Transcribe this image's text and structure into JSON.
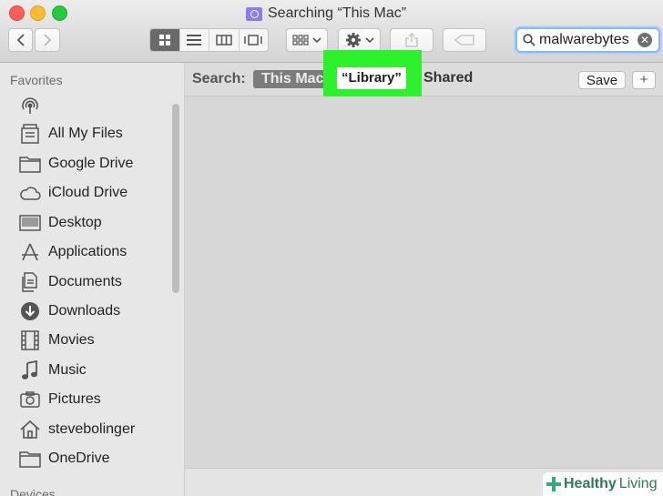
{
  "window": {
    "title": "Searching “This Mac”"
  },
  "toolbar": {
    "back_icon": "chevron-left-icon",
    "forward_icon": "chevron-right-icon",
    "views": [
      "icon-view",
      "list-view",
      "column-view",
      "cover-flow-view"
    ],
    "active_view": "icon-view",
    "arrange_icon": "arrange-grid-icon",
    "action_icon": "gear-icon",
    "share_icon": "share-icon",
    "tags_icon": "tag-icon",
    "search_value": "malwarebytes"
  },
  "sidebar": {
    "heading": "Favorites",
    "items": [
      {
        "label": "",
        "icon": "airdrop-icon"
      },
      {
        "label": "All My Files",
        "icon": "all-files-icon"
      },
      {
        "label": "Google Drive",
        "icon": "folder-icon"
      },
      {
        "label": "iCloud Drive",
        "icon": "cloud-icon"
      },
      {
        "label": "Desktop",
        "icon": "desktop-icon"
      },
      {
        "label": "Applications",
        "icon": "applications-icon"
      },
      {
        "label": "Documents",
        "icon": "documents-icon"
      },
      {
        "label": "Downloads",
        "icon": "downloads-icon"
      },
      {
        "label": "Movies",
        "icon": "movies-icon"
      },
      {
        "label": "Music",
        "icon": "music-icon"
      },
      {
        "label": "Pictures",
        "icon": "pictures-icon"
      },
      {
        "label": "stevebolinger",
        "icon": "home-icon"
      },
      {
        "label": "OneDrive",
        "icon": "folder-icon"
      }
    ],
    "devices_heading": "Devices"
  },
  "scope": {
    "label": "Search:",
    "this_mac": "This Mac",
    "library": "“Library”",
    "shared": "Shared",
    "save": "Save",
    "add": "+"
  },
  "watermark": {
    "part1": "Healthy",
    "part2": "Living"
  },
  "colors": {
    "highlight": "#2bf22b",
    "search_focus": "#8db7ec"
  }
}
